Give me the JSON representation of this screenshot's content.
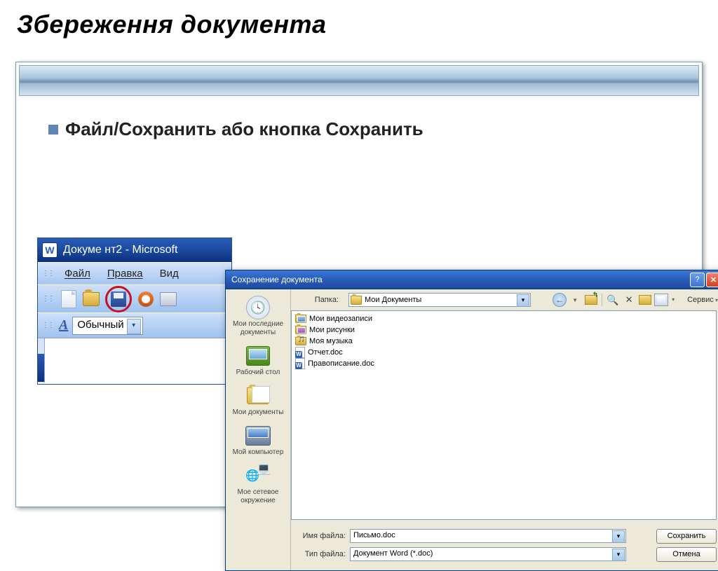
{
  "slide": {
    "title": "Збереження документа",
    "bullet": "Файл/Сохранить  або кнопка Сохранить"
  },
  "word": {
    "titlebar": "Докуме нт2 - Microsoft",
    "menu": {
      "file": "Файл",
      "edit": "Правка",
      "view": "Вид"
    },
    "style": "Обычный"
  },
  "dialog": {
    "title": "Сохранение документа",
    "folder_label": "Папка:",
    "folder_value": "Мои Документы",
    "tools": "Сервис",
    "places": {
      "recent": "Мои последние документы",
      "desktop": "Рабочий стол",
      "mydocs": "Мои документы",
      "mycomp": "Мой компьютер",
      "network": "Мое сетевое окружение"
    },
    "files": [
      {
        "type": "folder-vid",
        "name": "Мои видеозаписи"
      },
      {
        "type": "folder-img",
        "name": "Мои рисунки"
      },
      {
        "type": "folder-mus",
        "name": "Моя музыка"
      },
      {
        "type": "doc",
        "name": "Отчет.doc"
      },
      {
        "type": "doc",
        "name": "Правописание.doc"
      }
    ],
    "filename_label": "Имя файла:",
    "filename_value": "Письмо.doc",
    "filetype_label": "Тип файла:",
    "filetype_value": "Документ Word (*.doc)",
    "save_btn": "Сохранить",
    "cancel_btn": "Отмена"
  }
}
